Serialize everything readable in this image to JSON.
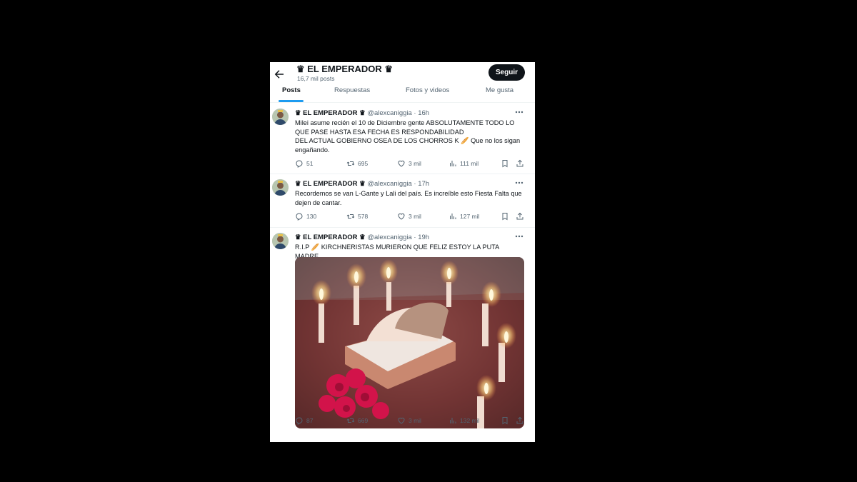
{
  "profile": {
    "name": "♛ EL EMPERADOR ♛",
    "post_count": "16,7 mil posts",
    "follow_label": "Seguir"
  },
  "tabs": [
    "Posts",
    "Respuestas",
    "Fotos y videos",
    "Me gusta"
  ],
  "tweets": [
    {
      "author": "♛ EL EMPERADOR ♛",
      "handle_time": "@alexcaniggia · 16h",
      "text": "Milei asume recién el 10 de Diciembre gente ABSOLUTAMENTE TODO LO QUE PASE HASTA ESA FECHA ES RESPONDABILIDAD\nDEL ACTUAL GOBIERNO OSEA DE LOS CHORROS K 🥖 Que no los sigan engañando.",
      "replies": "51",
      "reposts": "695",
      "likes": "3 mil",
      "views": "111 mil"
    },
    {
      "author": "♛ EL EMPERADOR ♛",
      "handle_time": "@alexcaniggia · 17h",
      "text": "Recordemos se van L-Gante y Lali del país. Es increíble esto Fiesta Falta que dejen de cantar.",
      "replies": "130",
      "reposts": "578",
      "likes": "3 mil",
      "views": "127 mil"
    },
    {
      "author": "♛ EL EMPERADOR ♛",
      "handle_time": "@alexcaniggia · 19h",
      "text": "R.I.P 🥖 KIRCHNERISTAS MURIERON QUE FELIZ ESTOY LA PUTA MADRE.",
      "replies": "87",
      "reposts": "669",
      "likes": "3 mil",
      "views": "132 mil"
    }
  ],
  "icons": {
    "back": "arrow-left-icon",
    "more": "more-horizontal-icon",
    "reply": "reply-icon",
    "repost": "repost-icon",
    "like": "heart-icon",
    "views": "views-chart-icon",
    "bookmark": "bookmark-icon",
    "share": "share-icon"
  },
  "colors": {
    "accent": "#1d9bf0",
    "text": "#0f1419",
    "muted": "#536471",
    "follow_bg": "#0f1419"
  }
}
